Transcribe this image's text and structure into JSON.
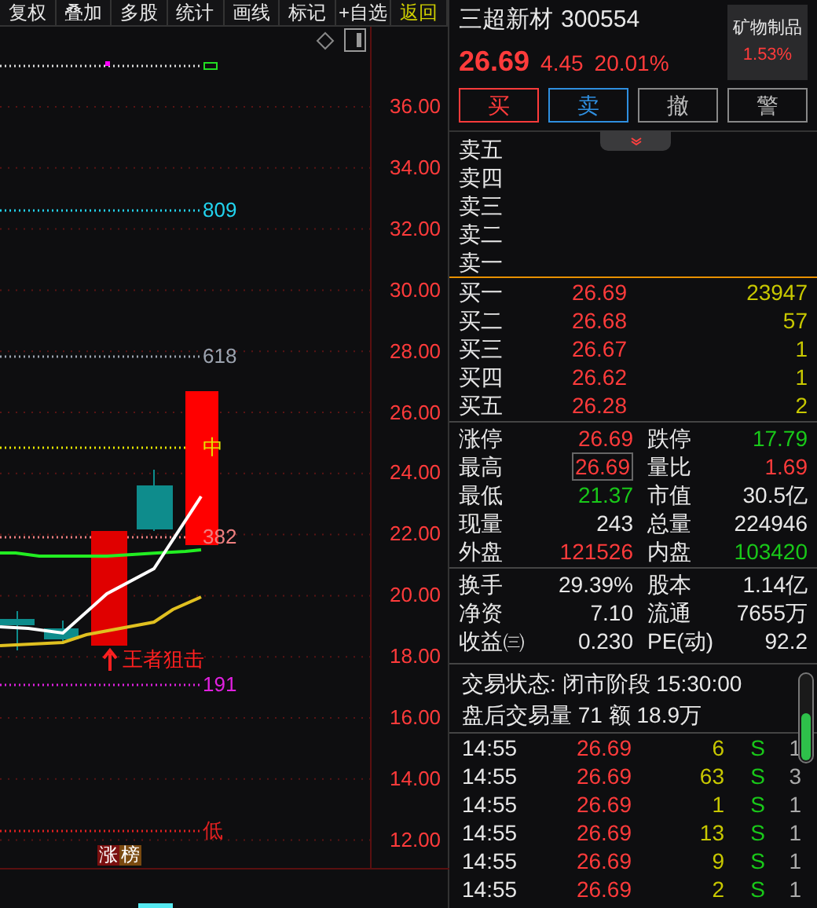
{
  "toolbar": [
    {
      "label": "复权",
      "kind": "normal"
    },
    {
      "label": "叠加",
      "kind": "normal"
    },
    {
      "label": "多股",
      "kind": "normal"
    },
    {
      "label": "统计",
      "kind": "normal"
    },
    {
      "label": "画线",
      "kind": "normal"
    },
    {
      "label": "标记",
      "kind": "normal"
    },
    {
      "label": "+自选",
      "kind": "normal"
    },
    {
      "label": "返回",
      "kind": "back"
    }
  ],
  "chart": {
    "price_ticks": [
      "36.00",
      "34.00",
      "32.00",
      "30.00",
      "28.00",
      "26.00",
      "24.00",
      "22.00",
      "20.00",
      "18.00",
      "16.00",
      "14.00",
      "12.00"
    ],
    "levels": [
      {
        "label": "809",
        "color": "#22d3ee"
      },
      {
        "label": "618",
        "color": "#9ca3af"
      },
      {
        "label": "中",
        "color": "#e5e500"
      },
      {
        "label": "382",
        "color": "#f08080"
      },
      {
        "label": "191",
        "color": "#e020e0"
      },
      {
        "label": "低",
        "color": "#e02020"
      }
    ],
    "signal": "王者狙击",
    "badge": "涨榜"
  },
  "quote": {
    "name": "三超新材",
    "code": "300554",
    "price": "26.69",
    "change": "4.45",
    "change_pct": "20.01%",
    "sector": "矿物制品",
    "sector_change": "1.53%"
  },
  "actions": [
    {
      "label": "买",
      "kind": "buy"
    },
    {
      "label": "卖",
      "kind": "sell"
    },
    {
      "label": "撤",
      "kind": "cancel"
    },
    {
      "label": "警",
      "kind": "alert"
    }
  ],
  "asks": [
    {
      "label": "卖五"
    },
    {
      "label": "卖四"
    },
    {
      "label": "卖三"
    },
    {
      "label": "卖二"
    },
    {
      "label": "卖一"
    }
  ],
  "bids": [
    {
      "label": "买一",
      "price": "26.69",
      "volume": "23947"
    },
    {
      "label": "买二",
      "price": "26.68",
      "volume": "57"
    },
    {
      "label": "买三",
      "price": "26.67",
      "volume": "1"
    },
    {
      "label": "买四",
      "price": "26.62",
      "volume": "1"
    },
    {
      "label": "买五",
      "price": "26.28",
      "volume": "2"
    }
  ],
  "stats": [
    {
      "label": "涨停",
      "value": "26.69",
      "kind": "up",
      "highlighted": false
    },
    {
      "label": "跌停",
      "value": "17.79",
      "kind": "down",
      "highlighted": false
    },
    {
      "label": "最高",
      "value": "26.69",
      "kind": "up",
      "highlighted": true
    },
    {
      "label": "量比",
      "value": "1.69",
      "kind": "up",
      "highlighted": false
    },
    {
      "label": "最低",
      "value": "21.37",
      "kind": "down",
      "highlighted": false
    },
    {
      "label": "市值",
      "value": "30.5亿",
      "kind": "flat",
      "highlighted": false
    },
    {
      "label": "现量",
      "value": "243",
      "kind": "flat",
      "highlighted": false
    },
    {
      "label": "总量",
      "value": "224946",
      "kind": "flat",
      "highlighted": false
    },
    {
      "label": "外盘",
      "value": "121526",
      "kind": "up",
      "highlighted": false
    },
    {
      "label": "内盘",
      "value": "103420",
      "kind": "down",
      "highlighted": false
    }
  ],
  "fundamentals": [
    {
      "label": "换手",
      "value": "29.39%"
    },
    {
      "label": "股本",
      "value": "1.14亿"
    },
    {
      "label": "净资",
      "value": "7.10"
    },
    {
      "label": "流通",
      "value": "7655万"
    },
    {
      "label": "收益㈢",
      "value": "0.230"
    },
    {
      "label": "PE(动)",
      "value": "92.2"
    }
  ],
  "status": [
    "交易状态: 闭市阶段 15:30:00",
    "盘后交易量 71 额 18.9万"
  ],
  "trades": [
    {
      "time": "14:55",
      "price": "26.69",
      "volume": "6",
      "side": "S",
      "count": "1"
    },
    {
      "time": "14:55",
      "price": "26.69",
      "volume": "63",
      "side": "S",
      "count": "3"
    },
    {
      "time": "14:55",
      "price": "26.69",
      "volume": "1",
      "side": "S",
      "count": "1"
    },
    {
      "time": "14:55",
      "price": "26.69",
      "volume": "13",
      "side": "S",
      "count": "1"
    },
    {
      "time": "14:55",
      "price": "26.69",
      "volume": "9",
      "side": "S",
      "count": "1"
    },
    {
      "time": "14:55",
      "price": "26.69",
      "volume": "2",
      "side": "S",
      "count": "1"
    }
  ]
}
